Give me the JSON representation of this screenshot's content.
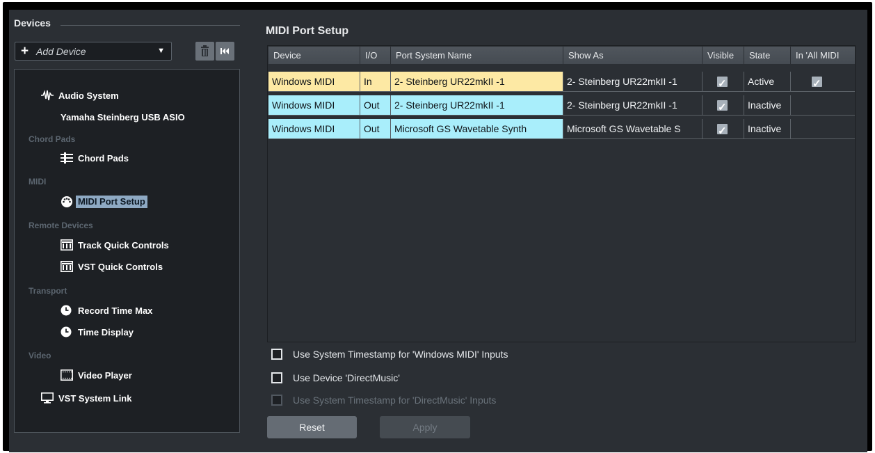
{
  "devices": {
    "title": "Devices",
    "add_device": {
      "label": "Add Device",
      "plus": "+",
      "arrow": "▼"
    },
    "tree": {
      "audio_system": "Audio System",
      "audio_driver": "Yamaha Steinberg USB ASIO",
      "cat_chord_pads": "Chord Pads",
      "chord_pads": "Chord Pads",
      "cat_midi": "MIDI",
      "midi_port_setup": "MIDI Port Setup",
      "cat_remote": "Remote Devices",
      "track_quick_controls": "Track Quick Controls",
      "vst_quick_controls": "VST Quick Controls",
      "cat_transport": "Transport",
      "record_time_max": "Record Time Max",
      "time_display": "Time Display",
      "cat_video": "Video",
      "video_player": "Video Player",
      "vst_system_link": "VST System Link"
    }
  },
  "midi_port_setup": {
    "title": "MIDI Port Setup",
    "columns": {
      "device": "Device",
      "io": "I/O",
      "port": "Port System Name",
      "show_as": "Show As",
      "visible": "Visible",
      "state": "State",
      "in_all_midi": "In 'All MIDI"
    },
    "rows": [
      {
        "device": "Windows MIDI",
        "io": "In",
        "port": "2- Steinberg UR22mkII -1",
        "show_as": "2- Steinberg UR22mkII -1",
        "visible": true,
        "state": "Active",
        "in_all_midi": true,
        "color": "#fde9a4"
      },
      {
        "device": "Windows MIDI",
        "io": "Out",
        "port": "2- Steinberg UR22mkII -1",
        "show_as": "2- Steinberg UR22mkII -1",
        "visible": true,
        "state": "Inactive",
        "in_all_midi": false,
        "color": "#a9eefb"
      },
      {
        "device": "Windows MIDI",
        "io": "Out",
        "port": "Microsoft GS Wavetable Synth",
        "show_as": "Microsoft GS Wavetable S",
        "visible": true,
        "state": "Inactive",
        "in_all_midi": false,
        "color": "#a9eefb"
      }
    ],
    "options": {
      "system_timestamp_windows": "Use System Timestamp for 'Windows MIDI' Inputs",
      "use_directmusic": "Use Device 'DirectMusic'",
      "system_timestamp_directmusic": "Use System Timestamp for 'DirectMusic' Inputs"
    },
    "buttons": {
      "reset": "Reset",
      "apply": "Apply"
    }
  }
}
